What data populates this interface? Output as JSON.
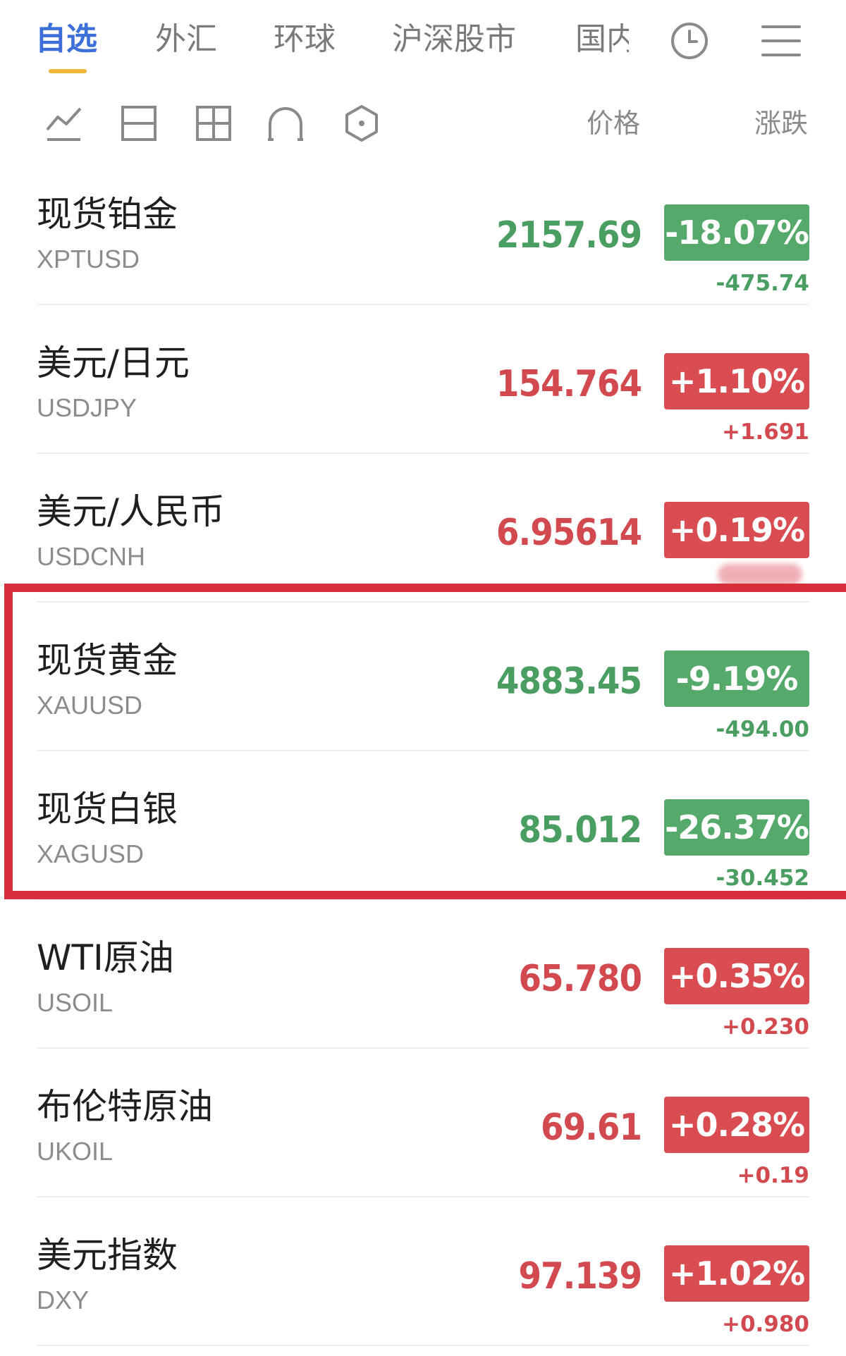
{
  "tabs": [
    {
      "label": "自选",
      "active": true
    },
    {
      "label": "外汇",
      "active": false
    },
    {
      "label": "环球",
      "active": false
    },
    {
      "label": "沪深股市",
      "active": false
    },
    {
      "label": "国内",
      "active": false
    }
  ],
  "header_icons": [
    "clock-icon",
    "menu-icon"
  ],
  "toolbar": {
    "icons": [
      "line-chart-icon",
      "two-row-layout-icon",
      "grid-layout-icon",
      "arch-layout-icon",
      "hexagon-icon"
    ],
    "price_header": "价格",
    "change_header": "涨跌"
  },
  "colors": {
    "up": "#d84c52",
    "down": "#55a96b",
    "accent": "#3d6fd8",
    "underline": "#f0b53a",
    "highlight": "#d6303a"
  },
  "quotes": [
    {
      "name": "现货铂金",
      "code": "XPTUSD",
      "price": "2157.69",
      "change_pct": "-18.07%",
      "change": "-475.74",
      "direction": "down"
    },
    {
      "name": "美元/日元",
      "code": "USDJPY",
      "price": "154.764",
      "change_pct": "+1.10%",
      "change": "+1.691",
      "direction": "up"
    },
    {
      "name": "美元/人民币",
      "code": "USDCNH",
      "price": "6.95614",
      "change_pct": "+0.19%",
      "change": "",
      "direction": "up"
    },
    {
      "name": "现货黄金",
      "code": "XAUUSD",
      "price": "4883.45",
      "change_pct": "-9.19%",
      "change": "-494.00",
      "direction": "down"
    },
    {
      "name": "现货白银",
      "code": "XAGUSD",
      "price": "85.012",
      "change_pct": "-26.37%",
      "change": "-30.452",
      "direction": "down"
    },
    {
      "name": "WTI原油",
      "code": "USOIL",
      "price": "65.780",
      "change_pct": "+0.35%",
      "change": "+0.230",
      "direction": "up"
    },
    {
      "name": "布伦特原油",
      "code": "UKOIL",
      "price": "69.61",
      "change_pct": "+0.28%",
      "change": "+0.19",
      "direction": "up"
    },
    {
      "name": "美元指数",
      "code": "DXY",
      "price": "97.139",
      "change_pct": "+1.02%",
      "change": "+0.980",
      "direction": "up"
    }
  ]
}
